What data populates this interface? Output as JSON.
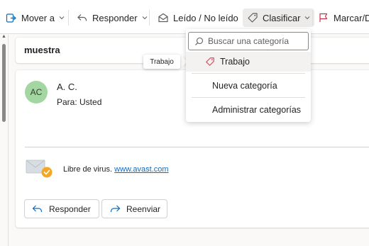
{
  "toolbar": {
    "move_label": "Mover a",
    "reply_label": "Responder",
    "read_label": "Leído / No leído",
    "classify_label": "Clasificar",
    "flag_label": "Marcar/De"
  },
  "message": {
    "subject": "muestra",
    "avatar_initials": "AC",
    "sender": "A. C.",
    "to_line": "Para:  Usted",
    "virus_text": "Libre de virus.",
    "virus_link": "www.avast.com",
    "reply_button": "Responder",
    "forward_button": "Reenviar"
  },
  "tooltip": {
    "text": "Trabajo"
  },
  "dropdown": {
    "search_placeholder": "Buscar una categoría",
    "category": "Trabajo",
    "new_category": "Nueva categoría",
    "manage_categories": "Administrar categorías"
  },
  "colors": {
    "accent": "#0f6cbd",
    "avatar_bg": "#a4d6a2",
    "category_tag": "#e0445b",
    "virus_badge": "#f5a623"
  },
  "icons": [
    "move-icon",
    "reply-icon",
    "envelope-icon",
    "tag-icon",
    "flag-icon",
    "search-icon",
    "forward-icon",
    "envelope-check-icon",
    "chevron-down-icon"
  ]
}
